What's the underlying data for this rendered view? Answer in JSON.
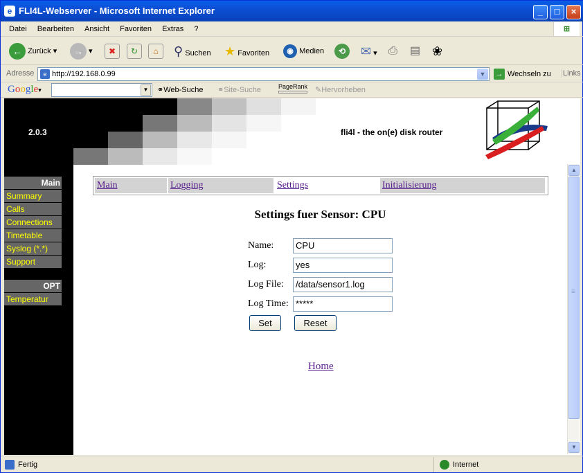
{
  "window": {
    "title": "FLI4L-Webserver - Microsoft Internet Explorer"
  },
  "menu": [
    "Datei",
    "Bearbeiten",
    "Ansicht",
    "Favoriten",
    "Extras",
    "?"
  ],
  "toolbar": {
    "back": "Zurück",
    "search": "Suchen",
    "favorites": "Favoriten",
    "media": "Medien"
  },
  "address": {
    "label": "Adresse",
    "url": "http://192.168.0.99",
    "go": "Wechseln zu",
    "links": "Links"
  },
  "google": {
    "logo": "Google",
    "websearch": "Web-Suche",
    "sitesearch": "Site-Suche",
    "pagerank": "PageRank",
    "highlight": "Hervorheben"
  },
  "page": {
    "version": "2.0.3",
    "tagline": "fli4l - the on(e) disk router",
    "nav_main": "Main",
    "nav_main_items": [
      "Summary",
      "Calls",
      "Connections",
      "Timetable",
      "Syslog (*.*)",
      "Support"
    ],
    "nav_opt": "OPT",
    "nav_opt_items": [
      "Temperatur"
    ],
    "tabs": [
      "Main",
      "Logging",
      "Settings",
      "Initialisierung"
    ],
    "heading": "Settings fuer Sensor: CPU",
    "form": {
      "name_label": "Name:",
      "name_value": "CPU",
      "log_label": "Log:",
      "log_value": "yes",
      "logfile_label": "Log File:",
      "logfile_value": "/data/sensor1.log",
      "logtime_label": "Log Time:",
      "logtime_value": "*****"
    },
    "set_button": "Set",
    "reset_button": "Reset",
    "home_link": "Home"
  },
  "status": {
    "left": "Fertig",
    "zone": "Internet"
  }
}
